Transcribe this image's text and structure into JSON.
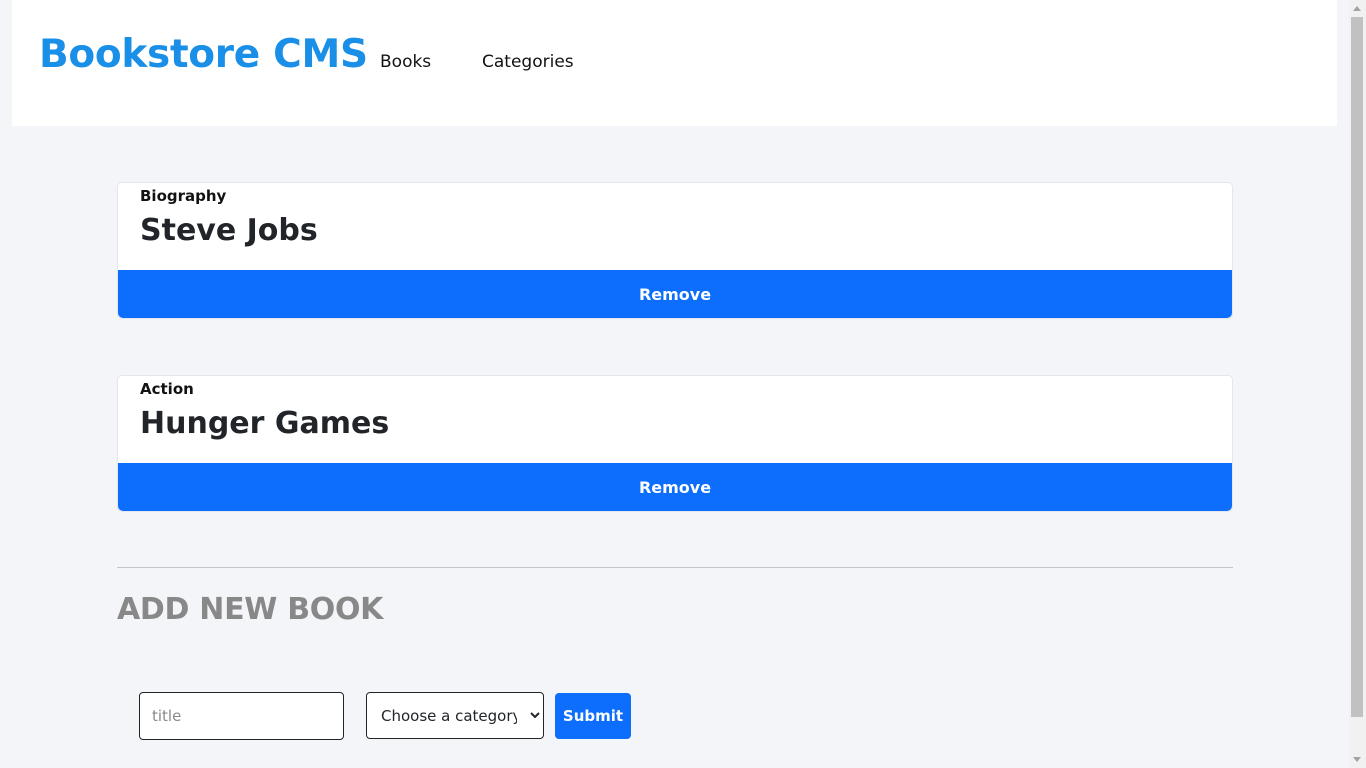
{
  "header": {
    "logo": "Bookstore CMS",
    "nav": [
      {
        "label": "Books"
      },
      {
        "label": "Categories"
      }
    ]
  },
  "books": [
    {
      "category": "Biography",
      "title": "Steve Jobs",
      "remove_label": "Remove"
    },
    {
      "category": "Action",
      "title": "Hunger Games",
      "remove_label": "Remove"
    }
  ],
  "add_form": {
    "heading": "ADD NEW BOOK",
    "title_placeholder": "title",
    "title_value": "",
    "category_selected": "Choose a category",
    "submit_label": "Submit"
  },
  "colors": {
    "brand": "#1a8fe8",
    "primary_button": "#0d6efd",
    "background": "#f4f5f9",
    "heading_gray": "#888888"
  },
  "icons": [
    "scroll-up-arrow-icon",
    "scroll-down-arrow-icon"
  ]
}
